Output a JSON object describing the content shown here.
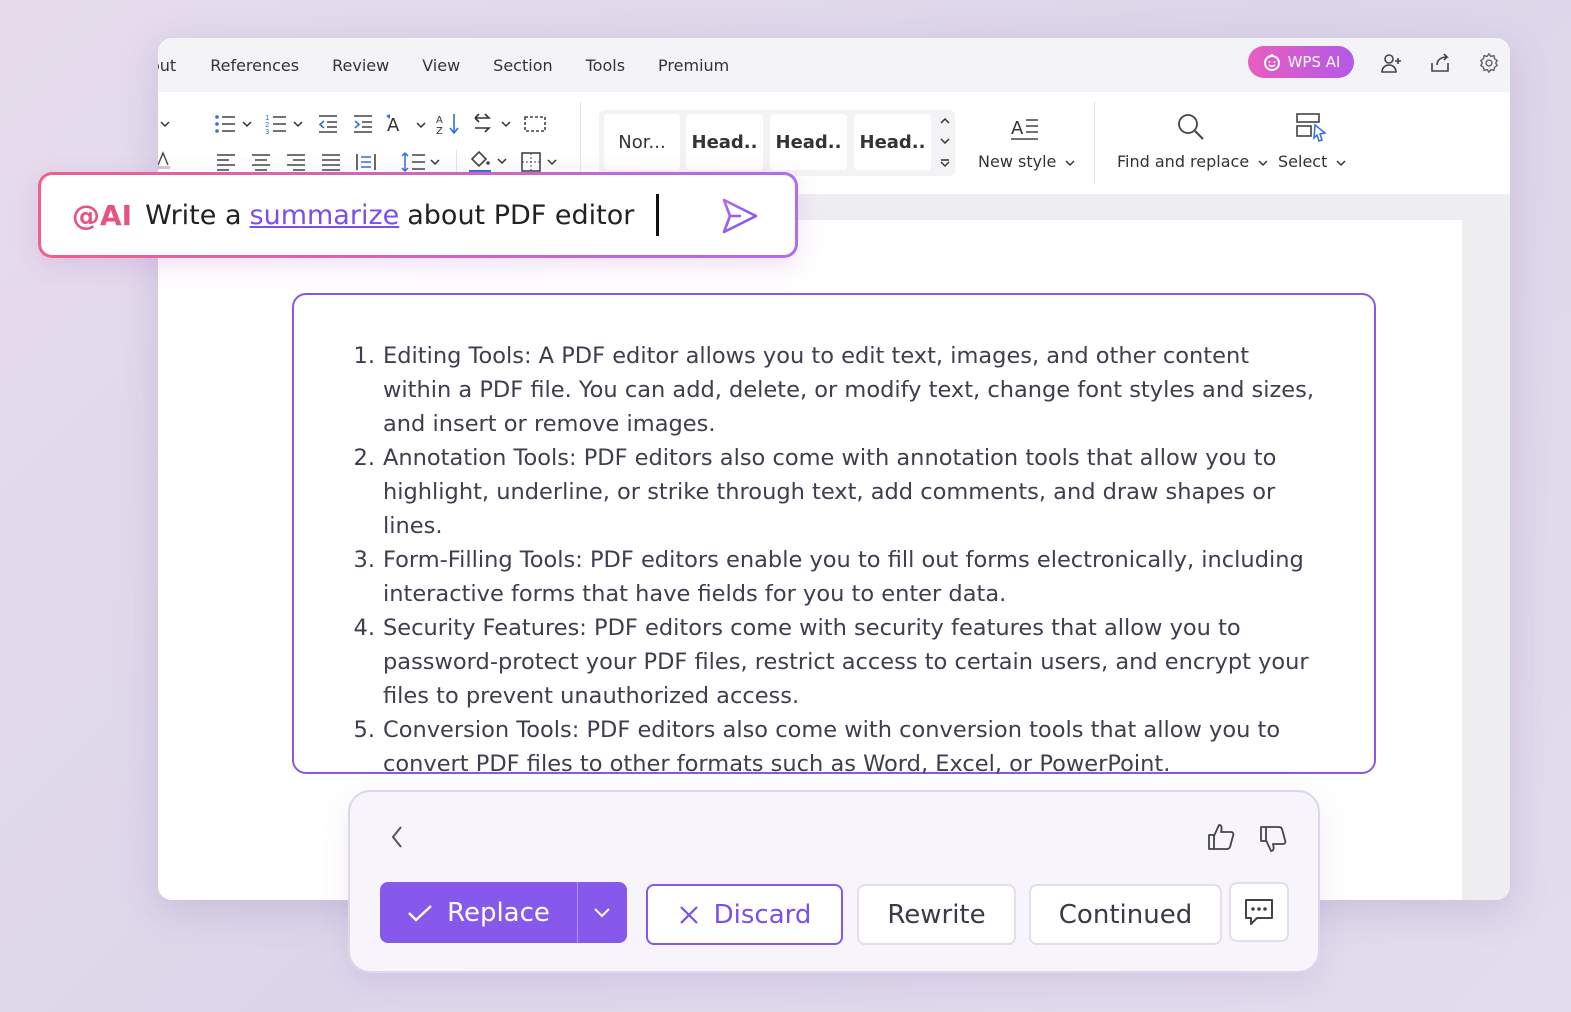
{
  "menubar": {
    "items": [
      "out",
      "References",
      "Review",
      "View",
      "Section",
      "Tools",
      "Premium"
    ],
    "wps_ai_label": "WPS AI"
  },
  "ribbon": {
    "styles": [
      "Nor...",
      "Head..",
      "Head..",
      "Head.."
    ],
    "new_style_label": "New style",
    "find_replace_label": "Find and replace",
    "select_label": "Select"
  },
  "prompt": {
    "tag": "@AI",
    "text_before": "Write a",
    "link_word": "summarize",
    "text_after": "about PDF editor"
  },
  "result": {
    "items": [
      {
        "num": "1.",
        "text": "Editing Tools: A PDF editor allows you to edit text, images, and other content within a PDF file. You can add, delete, or modify text, change font styles and sizes, and insert or remove images."
      },
      {
        "num": "2.",
        "text": "Annotation Tools: PDF editors also come with annotation tools that allow you to highlight, underline, or strike through text, add comments, and draw shapes or lines."
      },
      {
        "num": "3.",
        "text": "Form-Filling Tools: PDF editors enable you to fill out forms electronically, including interactive forms that have fields for you to enter data."
      },
      {
        "num": "4.",
        "text": "Security Features: PDF editors come with security features that allow you to password-protect your PDF files, restrict access to certain users, and encrypt your files to prevent unauthorized access."
      },
      {
        "num": "5.",
        "text": "Conversion Tools: PDF editors also come with conversion tools that allow you to convert PDF files to other formats such as Word, Excel, or PowerPoint."
      }
    ]
  },
  "actions": {
    "replace_label": "Replace",
    "discard_label": "Discard",
    "rewrite_label": "Rewrite",
    "continued_label": "Continued"
  },
  "colors": {
    "accent_purple": "#8658ec",
    "ai_pink": "#e8527f",
    "link_purple": "#7a4ff0"
  }
}
